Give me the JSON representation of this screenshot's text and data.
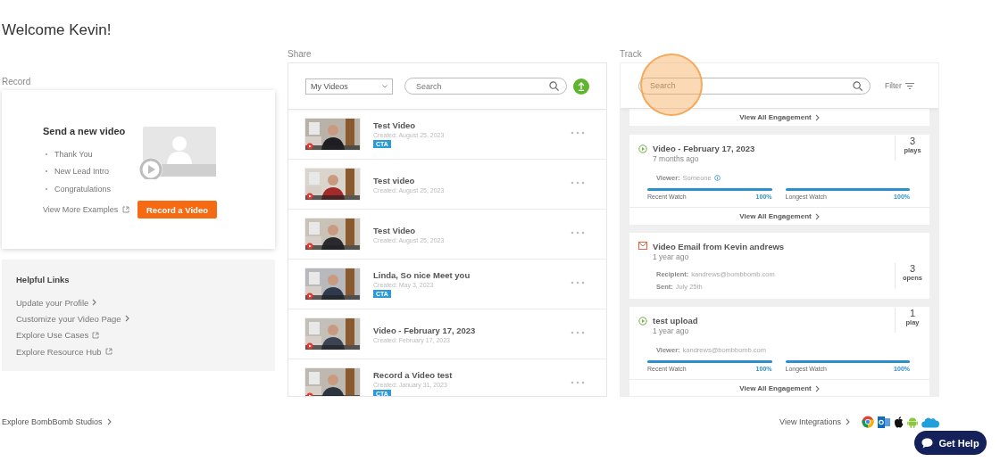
{
  "title": "Welcome Kevin!",
  "record": {
    "label": "Record",
    "heading": "Send a new video",
    "examples": [
      "Thank You",
      "New Lead Intro",
      "Congratulations"
    ],
    "more_link": "View More Examples",
    "button": "Record a Video"
  },
  "helpful_links": {
    "heading": "Helpful Links",
    "links": [
      {
        "text": "Update your Profile",
        "kind": "internal"
      },
      {
        "text": "Customize your Video Page",
        "kind": "internal"
      },
      {
        "text": "Explore Use Cases",
        "kind": "external"
      },
      {
        "text": "Explore Resource Hub",
        "kind": "external"
      }
    ]
  },
  "share": {
    "label": "Share",
    "dropdown": "My Videos",
    "search": {
      "placeholder": "Search"
    },
    "videos": [
      {
        "title": "Test Video",
        "created": "Created: August 25, 2023",
        "tag": "CTA"
      },
      {
        "title": "Test video",
        "created": "Created: August 25, 2023"
      },
      {
        "title": "Test Video",
        "created": "Created: August 25, 2023"
      },
      {
        "title": "Linda, So nice Meet you",
        "created": "Created: May 3, 2023",
        "tag": "CTA"
      },
      {
        "title": "Video - February 17, 2023",
        "created": "Created: February 17, 2023"
      },
      {
        "title": "Record a Video test",
        "created": "Created: January 31, 2023",
        "tag": "CTA"
      }
    ]
  },
  "track": {
    "label": "Track",
    "search": {
      "placeholder": "Search"
    },
    "filter": "Filter",
    "top_footer": "View All Engagement",
    "items": [
      {
        "kind": "video",
        "title": "Video - February 17, 2023",
        "ago": "7 months ago",
        "count": "3",
        "count_label": "plays",
        "viewer_label": "Viewer:",
        "viewer": "Someone",
        "info": true,
        "watches": [
          {
            "label": "Recent Watch",
            "level": 1,
            "reading": "100%"
          },
          {
            "label": "Longest Watch",
            "level": 1,
            "reading": "100%"
          }
        ],
        "footer": "View All Engagement"
      },
      {
        "kind": "email",
        "title": "Video Email from Kevin andrews",
        "ago": "1 year ago",
        "recipient_label": "Recipient:",
        "recipient": "kandrews@bombbomb.com",
        "sent_label": "Sent:",
        "sent": "July 25th",
        "count": "3",
        "count_label": "opens"
      },
      {
        "kind": "video",
        "title": "test upload",
        "ago": "1 year ago",
        "count": "1",
        "count_label": "play",
        "viewer_label": "Viewer:",
        "viewer": "kandrews@bombbomb.com",
        "info": false,
        "watches": [
          {
            "label": "Recent Watch",
            "level": 1,
            "reading": "100%"
          },
          {
            "label": "Longest Watch",
            "level": 1,
            "reading": "100%"
          }
        ],
        "footer": "View All Engagement"
      }
    ]
  },
  "footer": {
    "studios": "Explore BombBomb Studios",
    "integrations": "View Integrations"
  },
  "help_button": "Get Help"
}
